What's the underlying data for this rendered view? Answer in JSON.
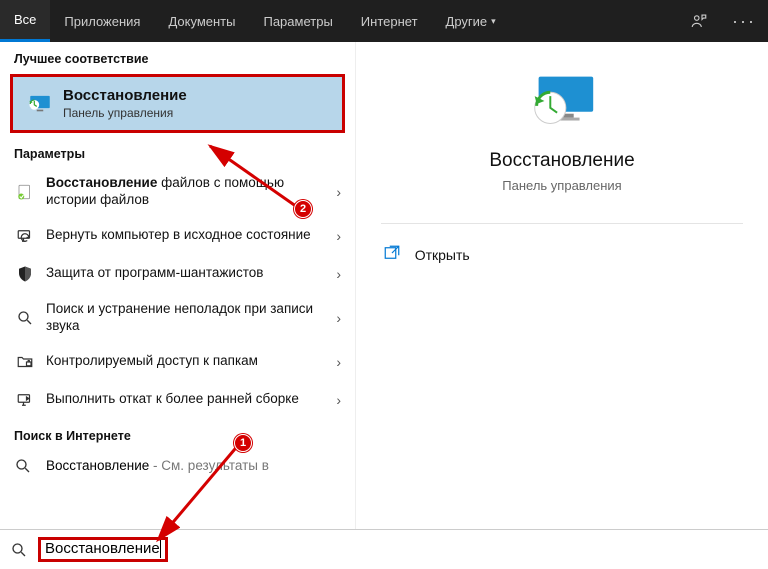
{
  "header": {
    "tabs": [
      {
        "label": "Все"
      },
      {
        "label": "Приложения"
      },
      {
        "label": "Документы"
      },
      {
        "label": "Параметры"
      },
      {
        "label": "Интернет"
      },
      {
        "label": "Другие"
      }
    ]
  },
  "sections": {
    "best_header": "Лучшее соответствие",
    "settings_header": "Параметры",
    "web_header": "Поиск в Интернете"
  },
  "best": {
    "title": "Восстановление",
    "subtitle": "Панель управления"
  },
  "settings": [
    {
      "strong": "Восстановление",
      "rest": " файлов с помощью истории файлов"
    },
    {
      "strong": "",
      "rest": "Вернуть компьютер в исходное состояние"
    },
    {
      "strong": "",
      "rest": "Защита от программ-шантажистов"
    },
    {
      "strong": "",
      "rest": "Поиск и устранение неполадок при записи звука"
    },
    {
      "strong": "",
      "rest": "Контролируемый доступ к папкам"
    },
    {
      "strong": "",
      "rest": "Выполнить откат к более ранней сборке"
    }
  ],
  "web": {
    "term": "Восстановление",
    "suffix": " - См. результаты в"
  },
  "detail": {
    "title": "Восстановление",
    "subtitle": "Панель управления",
    "open_label": "Открыть"
  },
  "search": {
    "value": "Восстановление"
  },
  "annotations": {
    "badge1": "1",
    "badge2": "2"
  },
  "colors": {
    "accent": "#0078d4",
    "highlight": "#c90000"
  }
}
